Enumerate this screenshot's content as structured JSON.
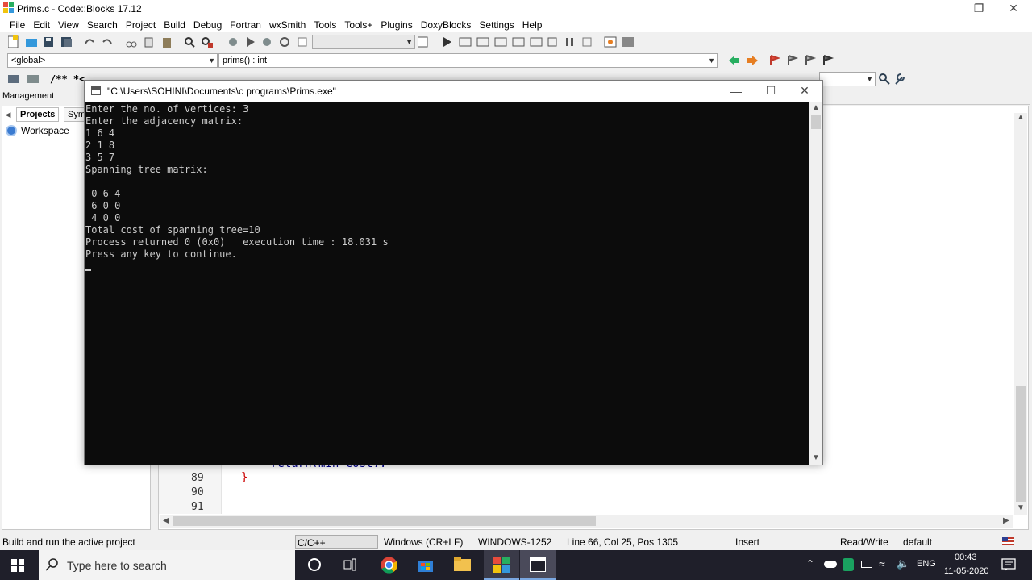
{
  "window": {
    "title": "Prims.c - Code::Blocks 17.12"
  },
  "menu": [
    "File",
    "Edit",
    "View",
    "Search",
    "Project",
    "Build",
    "Debug",
    "Fortran",
    "wxSmith",
    "Tools",
    "Tools+",
    "Plugins",
    "DoxyBlocks",
    "Settings",
    "Help"
  ],
  "toolbar": {
    "scope_combo": "<global>",
    "function_combo": "prims() : int",
    "doxy_label": "/** *<"
  },
  "management": {
    "header": "Management",
    "tabs": [
      "Projects",
      "Sym"
    ],
    "tree_item": "Workspace"
  },
  "editor": {
    "lines": [
      {
        "num": "89",
        "code": "}"
      },
      {
        "num": "90",
        "code": ""
      },
      {
        "num": "91",
        "code": ""
      }
    ],
    "partial_code": "return(min_cost);"
  },
  "console": {
    "title": "\"C:\\Users\\SOHINI\\Documents\\c programs\\Prims.exe\"",
    "lines": [
      "Enter the no. of vertices: 3",
      "Enter the adjacency matrix:",
      "1 6 4",
      "2 1 8",
      "3 5 7",
      "Spanning tree matrix:",
      "",
      " 0 6 4",
      " 6 0 0",
      " 4 0 0",
      "Total cost of spanning tree=10",
      "Process returned 0 (0x0)   execution time : 18.031 s",
      "Press any key to continue."
    ]
  },
  "statusbar": {
    "message": "Build and run the active project",
    "language": "C/C++",
    "line_endings": "Windows (CR+LF)",
    "encoding": "WINDOWS-1252",
    "position": "Line 66, Col 25, Pos 1305",
    "mode": "Insert",
    "access": "Read/Write",
    "profile": "default"
  },
  "taskbar": {
    "search_placeholder": "Type here to search",
    "language": "ENG",
    "time": "00:43",
    "date": "11-05-2020"
  },
  "colors": {
    "console_bg": "#0c0c0c",
    "console_fg": "#cccccc",
    "taskbar_bg": "#1f1f2a",
    "keyword_blue": "#00008b"
  }
}
